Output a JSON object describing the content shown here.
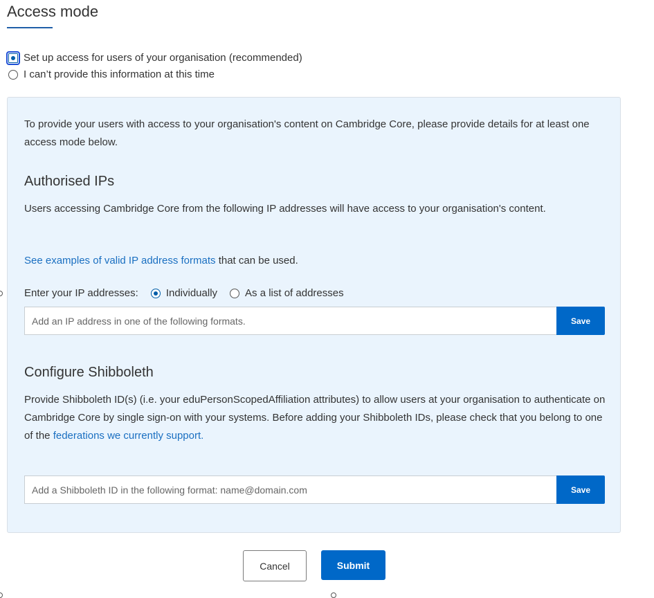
{
  "header": {
    "title": "Access mode"
  },
  "access_options": [
    {
      "label": "Set up access for users of your organisation (recommended)",
      "checked": true
    },
    {
      "label": "I can’t provide this information at this time",
      "checked": false
    }
  ],
  "panel": {
    "intro": "To provide your users with access to your organisation's content on Cambridge Core, please provide details for at least one access mode below.",
    "ips": {
      "heading": "Authorised IPs",
      "description": "Users accessing Cambridge Core from the following IP addresses will have access to your organisation's content.",
      "examples_link": "See examples of valid IP address formats",
      "examples_suffix": " that can be used.",
      "mode_label": "Enter your IP addresses:",
      "mode_options": [
        {
          "label": "Individually",
          "checked": true
        },
        {
          "label": "As a list of addresses",
          "checked": false
        }
      ],
      "input_placeholder": "Add an IP address in one of the following formats.",
      "save_label": "Save"
    },
    "shibboleth": {
      "heading": "Configure Shibboleth",
      "description_prefix": "Provide Shibboleth ID(s) (i.e. your eduPersonScopedAffiliation attributes) to allow users at your organisation to authenticate on Cambridge Core by single sign-on with your systems. Before adding your Shibboleth IDs, please check that you belong to one of the ",
      "federations_link": "federations we currently support",
      "description_suffix": ".",
      "input_placeholder": "Add a Shibboleth ID in the following format: name@domain.com",
      "save_label": "Save"
    }
  },
  "footer": {
    "cancel_label": "Cancel",
    "submit_label": "Submit"
  },
  "colors": {
    "accent": "#0068c8",
    "link": "#1a6fc1",
    "panel_bg": "#eaf4fd"
  }
}
